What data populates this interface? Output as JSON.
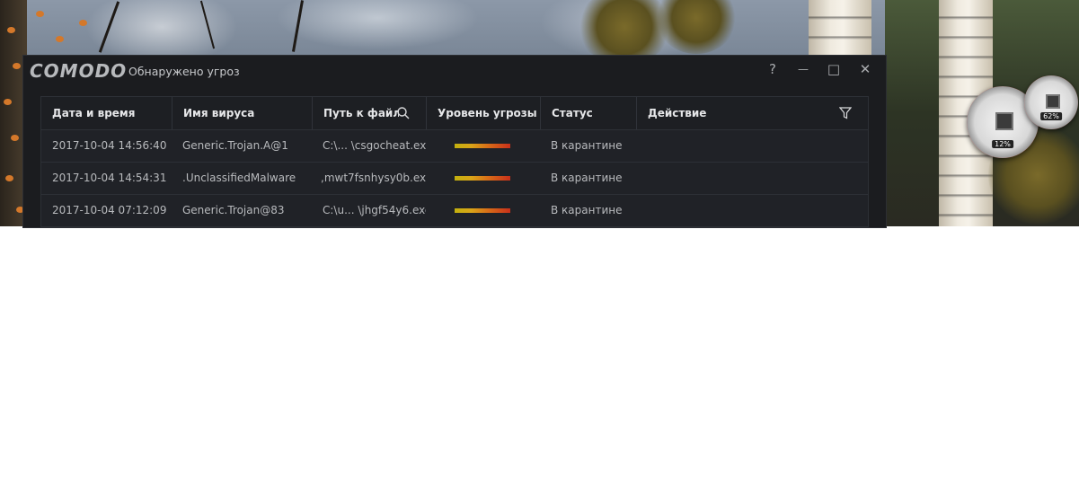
{
  "window": {
    "brand": "COMODO",
    "title": "Обнаружено угроз",
    "controls": {
      "help": "?",
      "minimize": "—",
      "maximize": "□",
      "close": "✕"
    }
  },
  "table": {
    "headers": {
      "datetime": "Дата и время",
      "virus_name": "Имя вируса",
      "file_path": "Путь к файлу",
      "threat_level": "Уровень угрозы",
      "status": "Статус",
      "action": "Действие"
    },
    "rows": [
      {
        "datetime": "2017-10-04 14:56:40",
        "virus_name": "Generic.Trojan.A@1",
        "file_path": "C:\\... \\csgocheat.exe",
        "status": "В карантине",
        "action": ""
      },
      {
        "datetime": "2017-10-04 14:54:31",
        "virus_name": ".UnclassifiedMalware",
        "file_path": ",mwt7fsnhysy0b.exe",
        "status": "В карантине",
        "action": ""
      },
      {
        "datetime": "2017-10-04 07:12:09",
        "virus_name": "Generic.Trojan@83",
        "file_path": "C:\\u... \\jhgf54y6.exe",
        "status": "В карантине",
        "action": ""
      }
    ]
  },
  "gadgets": {
    "cpu": "12%",
    "memory": "62%"
  },
  "colors": {
    "window_bg": "#1b1c1f",
    "threat_low": "#c2b10e",
    "threat_high": "#c8301a"
  }
}
